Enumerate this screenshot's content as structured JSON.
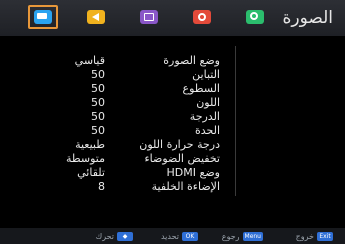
{
  "header": {
    "title": "الصورة",
    "tabs": [
      {
        "icon": "picture-settings-icon",
        "color": "#2aa3f0",
        "active": true
      },
      {
        "icon": "sound-icon",
        "color": "#f0b21e",
        "active": false
      },
      {
        "icon": "time-icon",
        "color": "#8a57c8",
        "active": false
      },
      {
        "icon": "setup-icon",
        "color": "#e34a3a",
        "active": false
      },
      {
        "icon": "search-icon",
        "color": "#2bbd6d",
        "active": false
      }
    ],
    "active_border_color": "#e7973a"
  },
  "settings": [
    {
      "label": "وضع الصورة",
      "value": "قياسي"
    },
    {
      "label": "التباين",
      "value": "50"
    },
    {
      "label": "السطوع",
      "value": "50"
    },
    {
      "label": "اللون",
      "value": "50"
    },
    {
      "label": "الدرجة",
      "value": "50"
    },
    {
      "label": "الحدة",
      "value": "50"
    },
    {
      "label": "درجة حرارة اللون",
      "value": "طبيعية"
    },
    {
      "label": "تخفيض الضوضاء",
      "value": "متوسطة"
    },
    {
      "label": "وضع HDMI",
      "value": "تلقائي"
    },
    {
      "label": "الإضاءة الخلفية",
      "value": "8"
    }
  ],
  "footer": {
    "hints": [
      {
        "key": "Exit",
        "label": "خروج"
      },
      {
        "key": "Menu",
        "label": "رجوع"
      },
      {
        "key": "OK",
        "label": "تحديد"
      },
      {
        "key": "◆",
        "label": "تحرك"
      }
    ]
  }
}
